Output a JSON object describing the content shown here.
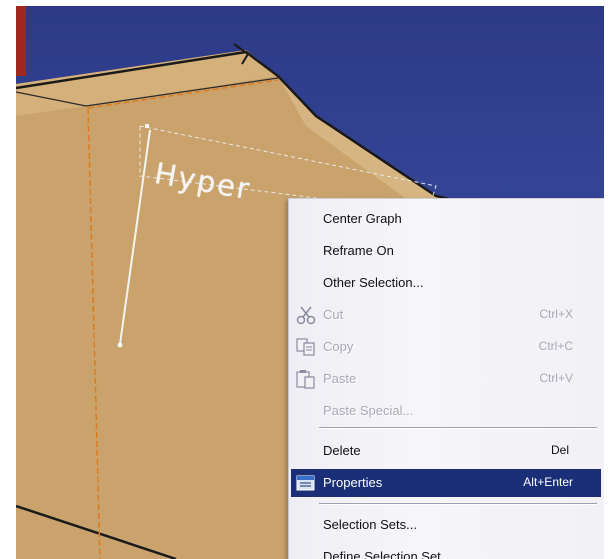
{
  "scene": {
    "annotation_text": "Hyper",
    "colors": {
      "background": "#33438f",
      "part_face": "#c9a36b",
      "part_face_shadow": "#b48e5a",
      "edge": "#1a1a1a",
      "highlight_orange": "#e07a1e"
    }
  },
  "context_menu": {
    "items": [
      {
        "label": "Center Graph",
        "shortcut": "",
        "enabled": true
      },
      {
        "label": "Reframe On",
        "shortcut": "",
        "enabled": true
      },
      {
        "label": "Other Selection...",
        "shortcut": "",
        "enabled": true
      },
      {
        "label": "Cut",
        "shortcut": "Ctrl+X",
        "enabled": false,
        "icon": "scissors-icon"
      },
      {
        "label": "Copy",
        "shortcut": "Ctrl+C",
        "enabled": false,
        "icon": "copy-icon"
      },
      {
        "label": "Paste",
        "shortcut": "Ctrl+V",
        "enabled": false,
        "icon": "paste-icon"
      },
      {
        "label": "Paste Special...",
        "shortcut": "",
        "enabled": false
      },
      {
        "label": "Delete",
        "shortcut": "Del",
        "enabled": true
      },
      {
        "label": "Properties",
        "shortcut": "Alt+Enter",
        "enabled": true,
        "highlighted": true,
        "icon": "properties-icon"
      },
      {
        "label": "Selection Sets...",
        "shortcut": "",
        "enabled": true
      },
      {
        "label": "Define Selection Set",
        "shortcut": "",
        "enabled": true
      }
    ],
    "highlight_color": "#1a2f78"
  }
}
